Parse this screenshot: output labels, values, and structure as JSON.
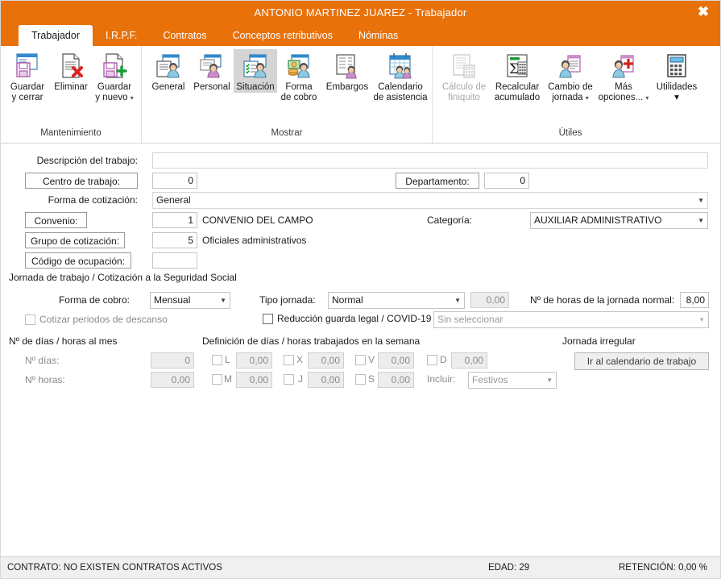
{
  "window": {
    "title": "ANTONIO MARTINEZ JUAREZ - Trabajador",
    "close_label": "✖",
    "accent_color": "#e8710a"
  },
  "tabs": [
    {
      "label": "Trabajador",
      "active": true
    },
    {
      "label": "I.R.P.F.",
      "active": false
    },
    {
      "label": "Contratos",
      "active": false
    },
    {
      "label": "Conceptos retributivos",
      "active": false
    },
    {
      "label": "Nóminas",
      "active": false
    }
  ],
  "ribbon": {
    "groups": [
      {
        "label": "Mantenimiento",
        "buttons": [
          {
            "name": "guardar-y-cerrar",
            "line1": "Guardar",
            "line2": "y cerrar",
            "icon": "save-close-icon",
            "state": "normal",
            "caret": false
          },
          {
            "name": "eliminar",
            "line1": "Eliminar",
            "line2": "",
            "icon": "delete-icon",
            "state": "normal",
            "caret": false
          },
          {
            "name": "guardar-y-nuevo",
            "line1": "Guardar",
            "line2": "y nuevo",
            "icon": "save-new-icon",
            "state": "normal",
            "caret": true
          }
        ]
      },
      {
        "label": "Mostrar",
        "buttons": [
          {
            "name": "general",
            "line1": "General",
            "line2": "",
            "icon": "person-general-icon",
            "state": "normal",
            "caret": false
          },
          {
            "name": "personal",
            "line1": "Personal",
            "line2": "",
            "icon": "person-personal-icon",
            "state": "normal",
            "caret": false
          },
          {
            "name": "situacion",
            "line1": "Situación",
            "line2": "",
            "icon": "person-situation-icon",
            "state": "selected",
            "caret": false
          },
          {
            "name": "forma-de-cobro",
            "line1": "Forma",
            "line2": "de cobro",
            "icon": "money-person-icon",
            "state": "normal",
            "caret": false
          },
          {
            "name": "embargos",
            "line1": "Embargos",
            "line2": "",
            "icon": "document-person-icon",
            "state": "normal",
            "caret": false
          },
          {
            "name": "calendario-de-asistencia",
            "line1": "Calendario",
            "line2": "de asistencia",
            "icon": "calendar-people-icon",
            "state": "normal",
            "caret": false
          }
        ]
      },
      {
        "label": "Útiles",
        "buttons": [
          {
            "name": "calculo-de-finiquito",
            "line1": "Cálculo de",
            "line2": "finiquito",
            "icon": "calculator-doc-icon",
            "state": "disabled",
            "caret": false
          },
          {
            "name": "recalcular-acumulado",
            "line1": "Recalcular",
            "line2": "acumulado",
            "icon": "sigma-calc-icon",
            "state": "normal",
            "caret": false
          },
          {
            "name": "cambio-de-jornada",
            "line1": "Cambio de",
            "line2": "jornada",
            "icon": "person-list-icon",
            "state": "normal",
            "caret": true
          },
          {
            "name": "mas-opciones",
            "line1": "Más",
            "line2": "opciones...",
            "icon": "person-plus-icon",
            "state": "normal",
            "caret": true
          },
          {
            "name": "utilidades",
            "line1": "Utilidades",
            "line2": "",
            "icon": "calculator-icon",
            "state": "normal",
            "caret": true
          }
        ]
      }
    ]
  },
  "form": {
    "descripcion_label": "Descripción del trabajo:",
    "descripcion_value": "",
    "centro_trabajo_label": "Centro de trabajo:",
    "centro_trabajo_value": "0",
    "departamento_label": "Departamento:",
    "departamento_value": "0",
    "forma_cotizacion_label": "Forma de cotización:",
    "forma_cotizacion_value": "General",
    "convenio_label": "Convenio:",
    "convenio_code": "1",
    "convenio_name": "CONVENIO DEL CAMPO",
    "categoria_label": "Categoría:",
    "categoria_value": "AUXILIAR ADMINISTRATIVO",
    "grupo_cotizacion_label": "Grupo de cotización:",
    "grupo_cotizacion_code": "5",
    "grupo_cotizacion_name": "Oficiales administrativos",
    "codigo_ocupacion_label": "Código de ocupación:",
    "codigo_ocupacion_value": "",
    "jornada_section_title": "Jornada de trabajo / Cotización a la Seguridad Social",
    "forma_cobro_label": "Forma de cobro:",
    "forma_cobro_value": "Mensual",
    "tipo_jornada_label": "Tipo jornada:",
    "tipo_jornada_value": "Normal",
    "tipo_jornada_extra_value": "0,00",
    "horas_jornada_label": "Nº de horas de la jornada normal:",
    "horas_jornada_value": "8,00",
    "cotizar_descanso_label": "Cotizar periodos de descanso",
    "reduccion_label": "Reducción guarda legal / COVID-19",
    "reduccion_select_value": "Sin seleccionar",
    "dias_mes_title": "Nº de días / horas al mes",
    "n_dias_label": "Nº días:",
    "n_dias_value": "0",
    "n_horas_label": "Nº horas:",
    "n_horas_value": "0,00",
    "semana_title": "Definición de días / horas trabajados en la semana",
    "week_days": [
      {
        "letter": "L",
        "value": "0,00"
      },
      {
        "letter": "M",
        "value": "0,00"
      },
      {
        "letter": "X",
        "value": "0,00"
      },
      {
        "letter": "J",
        "value": "0,00"
      },
      {
        "letter": "V",
        "value": "0,00"
      },
      {
        "letter": "S",
        "value": "0,00"
      },
      {
        "letter": "D",
        "value": "0,00"
      }
    ],
    "incluir_label": "Incluir:",
    "incluir_value": "Festivos",
    "jornada_irregular_title": "Jornada irregular",
    "ir_calendario_label": "Ir al calendario de trabajo"
  },
  "statusbar": {
    "contrato": "CONTRATO: NO EXISTEN CONTRATOS ACTIVOS",
    "edad": "EDAD: 29",
    "retencion": "RETENCIÓN: 0,00 %"
  }
}
